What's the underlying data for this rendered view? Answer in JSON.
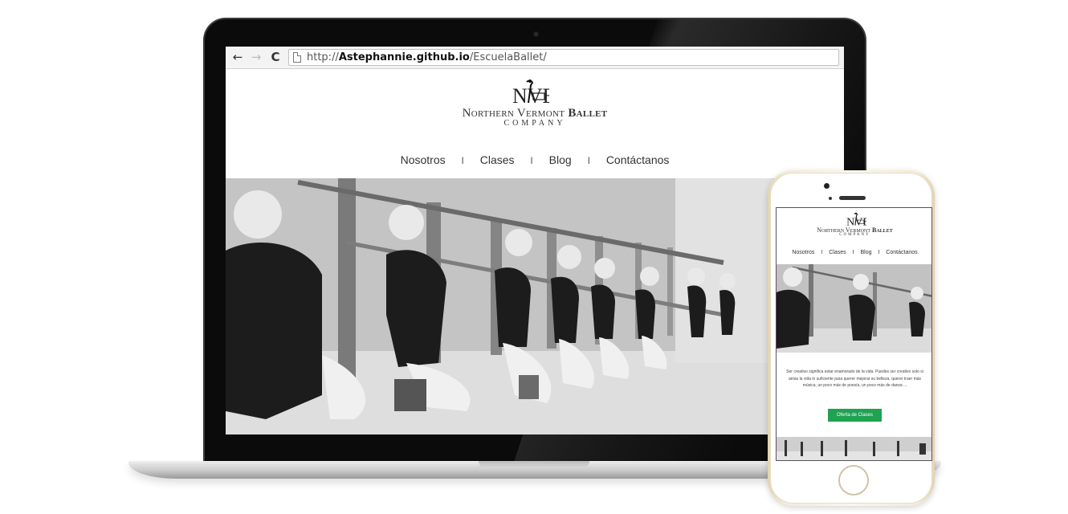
{
  "browser": {
    "back_icon": "←",
    "forward_icon": "→",
    "reload_icon": "C",
    "url_scheme": "http://",
    "url_host": "Astephannie.github.io",
    "url_path": "/EscuelaBallet/"
  },
  "site": {
    "logo_text": "NVB",
    "brand_line1_a": "Northern Vermont ",
    "brand_line1_b": "Ballet",
    "brand_line2": "COMPANY",
    "menu": [
      {
        "label": "Nosotros"
      },
      {
        "label": "Clases"
      },
      {
        "label": "Blog"
      },
      {
        "label": "Contáctanos"
      }
    ],
    "menu_separator": "I",
    "hero_style": "grayscale photo of young ballet students at the barre"
  },
  "mobile": {
    "body_text": "Ser creativo significa estar enamorado de la vida. Puedes ser creativo solo si amas la vida lo suficiente para querer mejorar su belleza, querer traer más música, un poco más de poesía, un poco más de danza ...",
    "cta_label": "Oferta de Clases"
  },
  "colors": {
    "cta_green": "#1fa252",
    "text_dark": "#333333",
    "laptop_bezel": "#0b0b0b",
    "phone_gold": "#f4ead6"
  }
}
